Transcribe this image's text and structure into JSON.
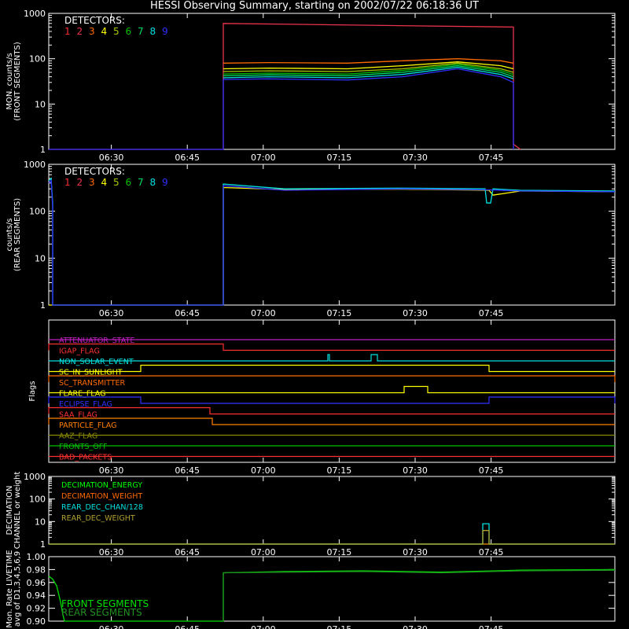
{
  "title": "HESSI Observing Summary, starting on 2002/07/22 06:18:36 UT",
  "colors": {
    "axis": "#ffffff",
    "det": [
      "#ff3030",
      "#e8334c",
      "#ff6a00",
      "#ffff00",
      "#a8c800",
      "#00c000",
      "#00e060",
      "#00e0e0",
      "#3030ff"
    ]
  },
  "chart_data": [
    {
      "id": "front",
      "type": "line",
      "ylabel": [
        "MON. counts/s",
        "(FRONT SEGMENTS)"
      ],
      "yscale": "log",
      "ylim": [
        1,
        1000
      ],
      "yticks": [
        "1",
        "10",
        "100",
        "1000"
      ],
      "xticks": [
        "06:30",
        "06:45",
        "07:00",
        "07:15",
        "07:30",
        "07:45"
      ],
      "legend": {
        "title": "DETECTORS:",
        "labels": [
          "1",
          "2",
          "3",
          "4",
          "5",
          "6",
          "7",
          "8",
          "9"
        ]
      },
      "series": [
        {
          "label": "2",
          "x": [
            0,
            222,
            222,
            591,
            591,
            600
          ],
          "y": [
            1,
            1,
            600,
            500,
            1.3,
            1
          ]
        },
        {
          "label": "3",
          "x": [
            222,
            280,
            380,
            450,
            520,
            575,
            591
          ],
          "y": [
            80,
            82,
            80,
            90,
            100,
            90,
            80
          ]
        },
        {
          "label": "4",
          "x": [
            222,
            280,
            380,
            450,
            520,
            575,
            591
          ],
          "y": [
            60,
            62,
            60,
            70,
            85,
            70,
            60
          ]
        },
        {
          "label": "5",
          "x": [
            222,
            280,
            380,
            450,
            520,
            575,
            591
          ],
          "y": [
            52,
            54,
            52,
            60,
            80,
            60,
            50
          ]
        },
        {
          "label": "6",
          "x": [
            222,
            280,
            380,
            450,
            520,
            575,
            591
          ],
          "y": [
            46,
            48,
            46,
            55,
            75,
            55,
            45
          ]
        },
        {
          "label": "7",
          "x": [
            222,
            280,
            380,
            450,
            520,
            575,
            591
          ],
          "y": [
            42,
            44,
            42,
            50,
            70,
            50,
            40
          ]
        },
        {
          "label": "8",
          "x": [
            222,
            280,
            380,
            450,
            520,
            575,
            591
          ],
          "y": [
            38,
            40,
            38,
            45,
            65,
            45,
            36
          ]
        },
        {
          "label": "9",
          "x": [
            0,
            222,
            222,
            280,
            380,
            450,
            520,
            575,
            591,
            591
          ],
          "y": [
            1,
            1,
            35,
            36,
            34,
            40,
            60,
            40,
            30,
            1
          ]
        }
      ]
    },
    {
      "id": "rear",
      "type": "line",
      "ylabel": [
        "counts/s",
        "(REAR SEGMENTS)"
      ],
      "yscale": "log",
      "ylim": [
        1,
        1000
      ],
      "yticks": [
        "1",
        "10",
        "100",
        "1000"
      ],
      "xticks": [
        "06:30",
        "06:45",
        "07:00",
        "07:15",
        "07:30",
        "07:45"
      ],
      "legend": {
        "title": "DETECTORS:",
        "labels": [
          "1",
          "2",
          "3",
          "4",
          "5",
          "6",
          "7",
          "8",
          "9"
        ]
      },
      "series": [
        {
          "label": "4",
          "x": [
            0,
            222,
            222,
            300,
            450,
            560,
            565,
            600,
            720
          ],
          "y": [
            1,
            1,
            320,
            290,
            295,
            280,
            220,
            270,
            260
          ]
        },
        {
          "label": "8",
          "x": [
            0,
            3,
            5,
            5,
            222,
            222,
            300,
            450,
            555,
            557,
            562,
            565,
            600,
            720
          ],
          "y": [
            450,
            500,
            150,
            1,
            1,
            380,
            300,
            310,
            300,
            150,
            150,
            300,
            280,
            270
          ]
        },
        {
          "label": "9",
          "x": [
            0,
            3,
            5,
            5,
            222,
            222,
            300,
            450,
            560,
            600,
            720
          ],
          "y": [
            400,
            450,
            120,
            1,
            1,
            350,
            280,
            300,
            285,
            270,
            260
          ]
        }
      ]
    },
    {
      "id": "flags",
      "type": "line",
      "ylabel": [
        "Flags"
      ],
      "xticks": [
        "06:30",
        "06:45",
        "07:00",
        "07:15",
        "07:30",
        "07:45"
      ],
      "flags": [
        {
          "name": "ATTENUATOR_STATE",
          "color": "#c020c0",
          "on_ranges": []
        },
        {
          "name": "IGAP_FLAG",
          "color": "#ff3030",
          "on_ranges": [
            [
              0,
              222
            ]
          ]
        },
        {
          "name": "NON_SOLAR_EVENT",
          "color": "#00e0e0",
          "on_ranges": [
            [
              355,
              357
            ],
            [
              410,
              418
            ]
          ]
        },
        {
          "name": "SC_IN_SUNLIGHT",
          "color": "#ffff00",
          "on_ranges": [
            [
              117,
              560
            ]
          ]
        },
        {
          "name": "SC_TRANSMITTER",
          "color": "#ff6a00",
          "on_ranges": [
            [
              0,
              720
            ]
          ]
        },
        {
          "name": "FLARE_FLAG",
          "color": "#ffff00",
          "on_ranges": [
            [
              452,
              482
            ]
          ]
        },
        {
          "name": "ECLIPSE_FLAG",
          "color": "#3030ff",
          "on_ranges": [
            [
              0,
              117
            ],
            [
              560,
              720
            ]
          ]
        },
        {
          "name": "SAA_FLAG",
          "color": "#ff3030",
          "on_ranges": [
            [
              0,
              205
            ]
          ]
        },
        {
          "name": "PARTICLE_FLAG",
          "color": "#ff8000",
          "on_ranges": [
            [
              0,
              208
            ]
          ]
        },
        {
          "name": "AAZ_FLAG",
          "color": "#8a8a00",
          "on_ranges": []
        },
        {
          "name": "FRONTS_OFF",
          "color": "#00c000",
          "on_ranges": []
        },
        {
          "name": "BAD_PACKETS",
          "color": "#ff3030",
          "on_ranges": []
        }
      ]
    },
    {
      "id": "decimation",
      "type": "line",
      "ylabel": [
        "DECIMATION",
        "CHANNEL or weight"
      ],
      "yscale": "log",
      "ylim": [
        1,
        1000
      ],
      "yticks": [
        "1",
        "10",
        "100",
        "1000"
      ],
      "xticks": [
        "06:30",
        "06:45",
        "07:00",
        "07:15",
        "07:30",
        "07:45"
      ],
      "legend": {
        "labels": [
          "DECIMATION_ENERGY",
          "DECIMATION_WEIGHT",
          "REAR_DEC_CHAN/128",
          "REAR_DEC_WEIGHT"
        ]
      },
      "series": [
        {
          "label": "DECIMATION_ENERGY",
          "color": "#00ff00",
          "x": [
            0,
            720
          ],
          "y": [
            1,
            1
          ]
        },
        {
          "label": "DECIMATION_WEIGHT",
          "color": "#ff6a00",
          "x": [
            0,
            720
          ],
          "y": [
            1,
            1
          ]
        },
        {
          "label": "REAR_DEC_CHAN/128",
          "color": "#00e0e0",
          "x": [
            0,
            552,
            552,
            560,
            560,
            720
          ],
          "y": [
            1,
            1,
            8,
            8,
            1,
            1
          ]
        },
        {
          "label": "REAR_DEC_WEIGHT",
          "color": "#b0a030",
          "x": [
            0,
            552,
            552,
            560,
            560,
            720
          ],
          "y": [
            1,
            1,
            4,
            4,
            1,
            1
          ]
        }
      ]
    },
    {
      "id": "livetime",
      "type": "line",
      "ylabel": [
        "Mon. Rate LIVETIME",
        "avg of D1,3,4,5,6,9"
      ],
      "ylim": [
        0.9,
        1.0
      ],
      "yticks": [
        "0.90",
        "0.92",
        "0.94",
        "0.96",
        "0.98",
        "1.00"
      ],
      "xticks": [
        "06:30",
        "06:45",
        "07:00",
        "07:15",
        "07:30",
        "07:45"
      ],
      "legend": {
        "labels": [
          "FRONT SEGMENTS",
          "REAR SEGMENTS"
        ]
      },
      "series": [
        {
          "label": "FRONT SEGMENTS",
          "color": "#00e000",
          "x": [
            0,
            5,
            10,
            15,
            18,
            20,
            222,
            222,
            300,
            400,
            500,
            600,
            720
          ],
          "y": [
            0.97,
            0.965,
            0.955,
            0.93,
            0.91,
            0.9,
            0.9,
            0.975,
            0.977,
            0.978,
            0.976,
            0.979,
            0.98
          ]
        },
        {
          "label": "REAR SEGMENTS",
          "color": "#209020",
          "x": [
            222,
            222,
            300,
            400,
            500,
            600,
            720
          ],
          "y": [
            0.9,
            0.975,
            0.976,
            0.977,
            0.975,
            0.978,
            0.979
          ]
        }
      ]
    }
  ]
}
